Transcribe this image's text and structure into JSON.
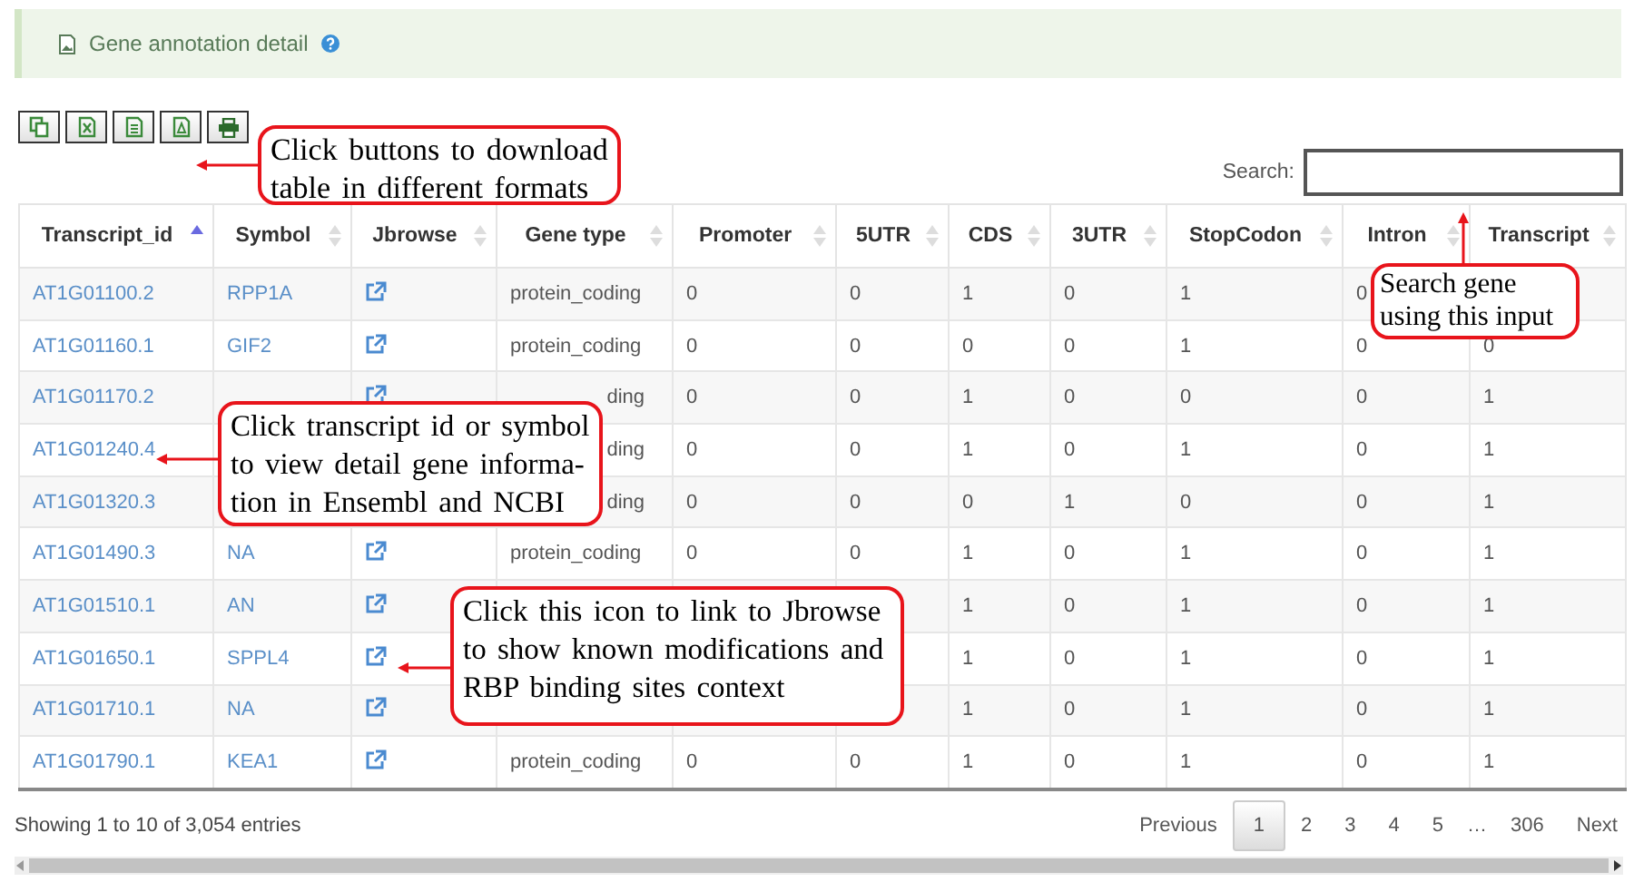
{
  "panel": {
    "title": "Gene annotation detail"
  },
  "export_buttons": [
    {
      "kind": "copy"
    },
    {
      "kind": "excel"
    },
    {
      "kind": "csv"
    },
    {
      "kind": "pdf"
    },
    {
      "kind": "print"
    }
  ],
  "search": {
    "label": "Search:"
  },
  "table": {
    "columns": [
      {
        "label": "Transcript_id",
        "sorted": true
      },
      {
        "label": "Symbol",
        "sorted": false
      },
      {
        "label": "Jbrowse",
        "sorted": false
      },
      {
        "label": "Gene type",
        "sorted": false
      },
      {
        "label": "Promoter",
        "sorted": false
      },
      {
        "label": "5UTR",
        "sorted": false
      },
      {
        "label": "CDS",
        "sorted": false
      },
      {
        "label": "3UTR",
        "sorted": false
      },
      {
        "label": "StopCodon",
        "sorted": false
      },
      {
        "label": "Intron",
        "sorted": false
      },
      {
        "label": "Transcript",
        "sorted": false
      }
    ],
    "rows": [
      {
        "transcript_id": "AT1G01100.2",
        "symbol": "RPP1A",
        "jbrowse_icon": true,
        "gene_type": "protein_coding",
        "values": {
          "promoter": "0",
          "utr5": "0",
          "cds": "1",
          "utr3": "0",
          "stop_codon": "1",
          "intron": "0"
        }
      },
      {
        "transcript_id": "AT1G01160.1",
        "symbol": "GIF2",
        "jbrowse_icon": true,
        "gene_type": "protein_coding",
        "values": {
          "promoter": "0",
          "utr5": "0",
          "cds": "0",
          "utr3": "0",
          "stop_codon": "1",
          "intron": "0",
          "transcript": "0"
        }
      },
      {
        "transcript_id": "AT1G01170.2",
        "jbrowse_icon": true,
        "gene_type_tail": "ding",
        "values": {
          "promoter": "0",
          "utr5": "0",
          "cds": "1",
          "utr3": "0",
          "stop_codon": "0",
          "intron": "0",
          "transcript": "1"
        }
      },
      {
        "transcript_id": "AT1G01240.4",
        "gene_type_tail": "ding",
        "values": {
          "promoter": "0",
          "utr5": "0",
          "cds": "1",
          "utr3": "0",
          "stop_codon": "1",
          "intron": "0",
          "transcript": "1"
        }
      },
      {
        "transcript_id": "AT1G01320.3",
        "gene_type_tail": "ding",
        "values": {
          "promoter": "0",
          "utr5": "0",
          "cds": "0",
          "utr3": "1",
          "stop_codon": "0",
          "intron": "0",
          "transcript": "1"
        }
      },
      {
        "transcript_id": "AT1G01490.3",
        "symbol": "NA",
        "jbrowse_icon": true,
        "gene_type": "protein_coding",
        "values": {
          "promoter": "0",
          "utr5": "0",
          "cds": "1",
          "utr3": "0",
          "stop_codon": "1",
          "intron": "0",
          "transcript": "1"
        }
      },
      {
        "transcript_id": "AT1G01510.1",
        "symbol": "AN",
        "jbrowse_icon": true,
        "values": {
          "cds": "1",
          "utr3": "0",
          "stop_codon": "1",
          "intron": "0",
          "transcript": "1"
        }
      },
      {
        "transcript_id": "AT1G01650.1",
        "symbol": "SPPL4",
        "jbrowse_icon": true,
        "values": {
          "cds": "1",
          "utr3": "0",
          "stop_codon": "1",
          "intron": "0",
          "transcript": "1"
        }
      },
      {
        "transcript_id": "AT1G01710.1",
        "symbol": "NA",
        "jbrowse_icon": true,
        "values": {
          "cds": "1",
          "utr3": "0",
          "stop_codon": "1",
          "intron": "0",
          "transcript": "1"
        }
      },
      {
        "transcript_id": "AT1G01790.1",
        "symbol": "KEA1",
        "jbrowse_icon": true,
        "gene_type": "protein_coding",
        "values": {
          "promoter": "0",
          "utr5": "0",
          "cds": "1",
          "utr3": "0",
          "stop_codon": "1",
          "intron": "0",
          "transcript": "1"
        }
      }
    ]
  },
  "info": "Showing 1 to 10 of 3,054 entries",
  "pagination": [
    {
      "label": "Previous",
      "kind": "nav",
      "selected": false
    },
    {
      "label": "1",
      "kind": "page",
      "selected": true
    },
    {
      "label": "2",
      "kind": "page",
      "selected": false
    },
    {
      "label": "3",
      "kind": "page",
      "selected": false
    },
    {
      "label": "4",
      "kind": "page",
      "selected": false
    },
    {
      "label": "5",
      "kind": "page",
      "selected": false
    },
    {
      "label": "…",
      "kind": "gap"
    },
    {
      "label": "306",
      "kind": "page",
      "selected": false
    },
    {
      "label": "Next",
      "kind": "nav",
      "selected": false
    }
  ],
  "annotations": [
    {
      "text": "Click buttons to download table in different formats"
    },
    {
      "text": "Search gene using this input"
    },
    {
      "text": "Click transcript id or symbol to view detail gene informa-tion in Ensembl and NCBI"
    },
    {
      "text": "Click this icon to link to Jbrowse to show known modifications and RBP binding sites context"
    }
  ]
}
